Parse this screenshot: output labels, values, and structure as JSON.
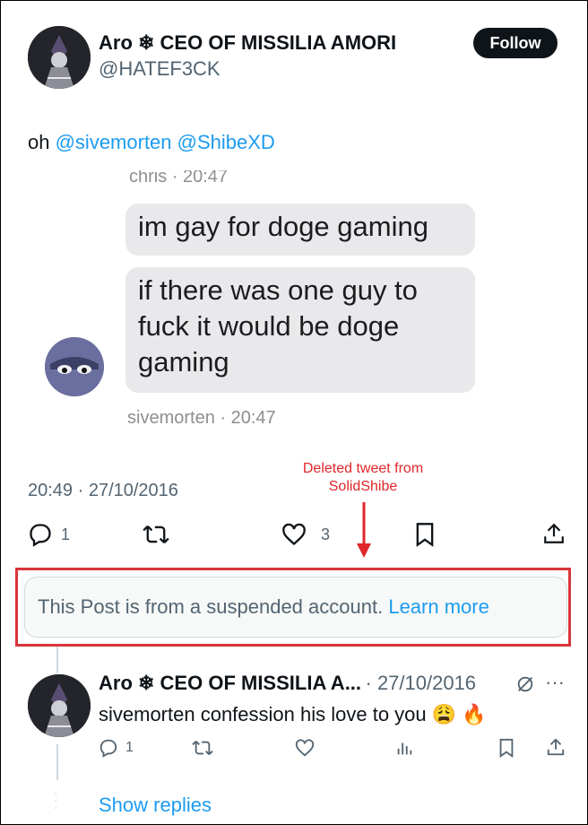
{
  "tweet": {
    "author_name": "Aro ❄ CEO OF MISSILIA AMORI",
    "handle": "@HATEF3CK",
    "follow_label": "Follow",
    "text_prefix": "oh ",
    "mentions": [
      "@sivemorten",
      "@ShibeXD"
    ],
    "timestamp": "20:49 · 27/10/2016",
    "reply_count": "1",
    "like_count": "3"
  },
  "screenshot": {
    "top_meta_partial": "chris · 20:47",
    "bubbles": [
      "im gay for doge gaming",
      "if there was one guy to fuck it would be doge gaming"
    ],
    "bubble2_lines": [
      "if there was one guy to",
      "fuck it would be doge",
      "gaming"
    ],
    "sender_meta": "sivemorten · 20:47"
  },
  "annotation": {
    "lines": [
      "Deleted tweet from",
      "SolidShibe"
    ],
    "color": "#e0262b"
  },
  "notice": {
    "text": "This Post is from a suspended account.",
    "link": "Learn more"
  },
  "reply": {
    "author_name": "Aro ❄ CEO OF MISSILIA A...",
    "date": "· 27/10/2016",
    "text": "sivemorten confession his love to you 😩 🔥",
    "reply_count": "1"
  },
  "show_replies": "Show replies",
  "colors": {
    "link": "#1d9bf0",
    "text": "#0f1419",
    "muted": "#536471",
    "annotation": "#e0262b"
  }
}
